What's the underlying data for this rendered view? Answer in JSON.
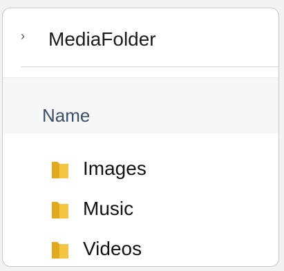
{
  "breadcrumb": {
    "chevron_icon": "chevron-right-icon",
    "title": "MediaFolder"
  },
  "columns": {
    "name_header": "Name"
  },
  "items": [
    {
      "label": "Images",
      "icon": "folder-icon"
    },
    {
      "label": "Music",
      "icon": "folder-icon"
    },
    {
      "label": "Videos",
      "icon": "folder-icon"
    }
  ],
  "colors": {
    "folder": "#f5c542",
    "folder_shade": "#e0a91e",
    "header_text": "#3a4f6a"
  }
}
